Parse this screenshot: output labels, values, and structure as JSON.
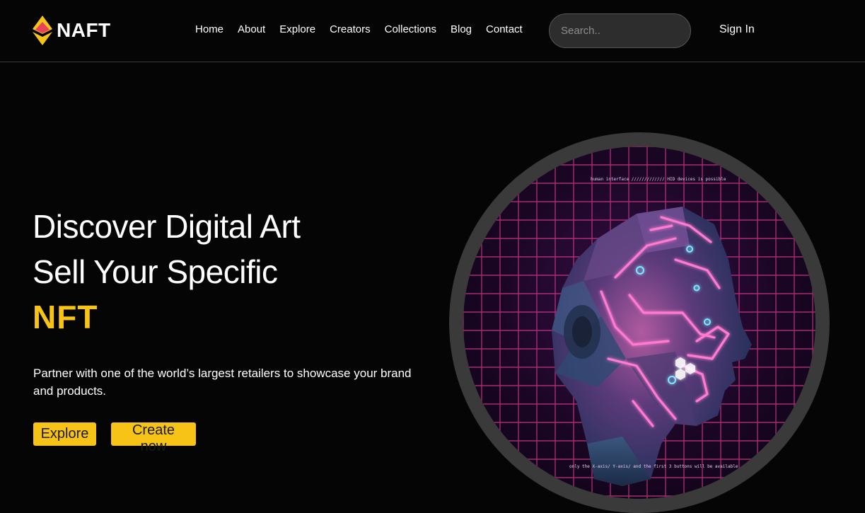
{
  "brand": {
    "name": "NAFT",
    "logo_colors": {
      "top": "#f7c316",
      "middle": "#e8435a",
      "bottom": "#f7c316"
    }
  },
  "nav": {
    "links": [
      "Home",
      "About",
      "Explore",
      "Creators",
      "Collections",
      "Blog",
      "Contact"
    ]
  },
  "search": {
    "placeholder": "Search.."
  },
  "auth": {
    "signin_label": "Sign In"
  },
  "hero": {
    "title_line1": "Discover Digital Art",
    "title_line2": "Sell Your Specific",
    "title_accent": "NFT",
    "description": "Partner with one of the world’s largest retailers to showcase your brand and products.",
    "buttons": {
      "explore": "Explore",
      "create": "Create now"
    }
  },
  "artwork": {
    "caption_top": "human interface ///////////// HID devices is possible",
    "caption_bottom": "only the X-axis/ Y-axis/ and the first 3 buttons will be available",
    "subject": "cyber-head-portrait"
  },
  "colors": {
    "background": "#050505",
    "accent": "#f7c316",
    "grid": "#d63a8c",
    "neon": "#ff7ad0"
  }
}
